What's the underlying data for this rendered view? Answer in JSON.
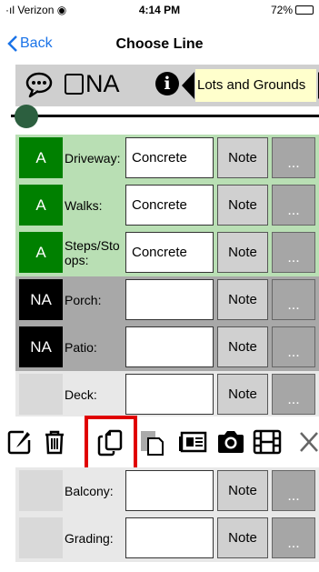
{
  "status_bar": {
    "carrier": "Verizon",
    "time": "4:14 PM",
    "battery": "72%",
    "battery_level": 0.72
  },
  "nav": {
    "back_label": "Back",
    "title": "Choose Line"
  },
  "toolbar": {
    "comment_icon": "speech-bubble-icon",
    "na_label": "NA",
    "info_icon": "info-icon",
    "section": "Lots and Grounds",
    "prev_icon": "triangle-left-icon",
    "next_icon": "triangle-right-icon"
  },
  "slider": {
    "value": 0.0
  },
  "colors": {
    "rating_a": "#008000",
    "rating_na": "#000000",
    "rating_none": "#d9d9d9",
    "row_a_bg": "#b9dfb4",
    "row_na_bg": "#a8a8a8",
    "row_none_bg": "#e8e8e8",
    "highlight": "#e00000",
    "accent": "#1a73e8"
  },
  "rows": [
    {
      "rating": "A",
      "label": "Driveway:",
      "value": "Concrete",
      "note": "Note",
      "more": "..."
    },
    {
      "rating": "A",
      "label": "Walks:",
      "value": "Concrete",
      "note": "Note",
      "more": "..."
    },
    {
      "rating": "A",
      "label": "Steps/Stoops:",
      "value": "Concrete",
      "note": "Note",
      "more": "..."
    },
    {
      "rating": "NA",
      "label": "Porch:",
      "value": "",
      "note": "Note",
      "more": "..."
    },
    {
      "rating": "NA",
      "label": "Patio:",
      "value": "",
      "note": "Note",
      "more": "..."
    },
    {
      "rating": "",
      "label": "Deck:",
      "value": "",
      "note": "Note",
      "more": "..."
    }
  ],
  "actions": [
    {
      "name": "edit-icon"
    },
    {
      "name": "trash-icon"
    },
    {
      "name": "copy-icon",
      "highlighted": true
    },
    {
      "name": "paste-icon"
    },
    {
      "name": "card-icon"
    },
    {
      "name": "camera-icon"
    },
    {
      "name": "film-icon"
    },
    {
      "name": "close-icon"
    }
  ],
  "rows_after": [
    {
      "rating": "",
      "label": "Balcony:",
      "value": "",
      "note": "Note",
      "more": "..."
    },
    {
      "rating": "",
      "label": "Grading:",
      "value": "",
      "note": "Note",
      "more": "..."
    }
  ]
}
